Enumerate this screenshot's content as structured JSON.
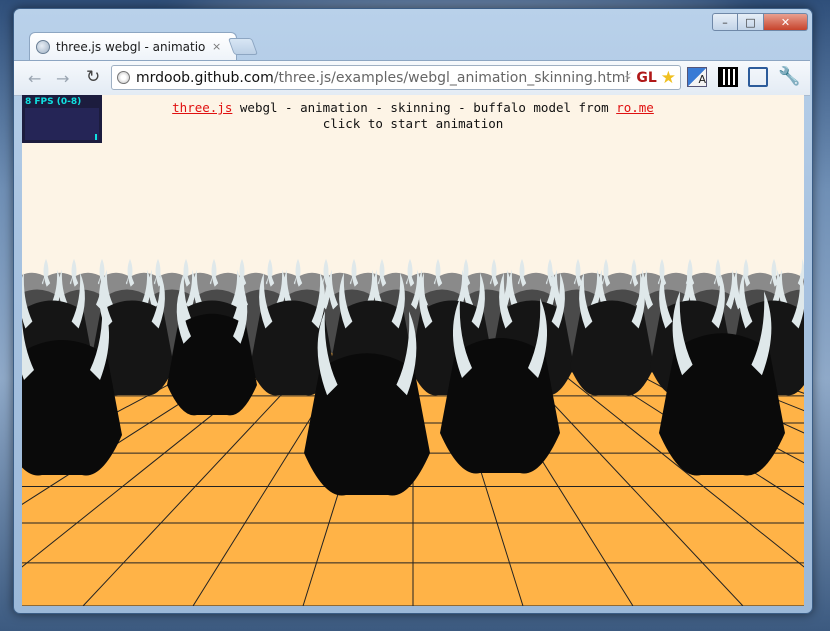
{
  "browser": {
    "tab_title": "three.js webgl - animation - ",
    "tab_close": "×",
    "controls": {
      "minimize": "–",
      "maximize": "□",
      "close": "✕"
    },
    "nav": {
      "back": "←",
      "forward": "→",
      "reload": "↻"
    },
    "url_host": "mrdoob.github.com",
    "url_path": "/three.js/examples/webgl_animation_skinning.html",
    "gl_badge": "GL",
    "bookmark_icon": "star-icon",
    "extensions": [
      "translate-icon",
      "qr-code-icon",
      "fullscreen-icon",
      "wrench-icon"
    ]
  },
  "page": {
    "stats": {
      "fps_text": "8 FPS (0-8)",
      "accent": "#10e0e0",
      "bg": "#1c1c3e"
    },
    "info": {
      "link1": "three.js",
      "text1": " webgl - animation - skinning - buffalo model from ",
      "link2": "ro.me",
      "line2": "click to start animation"
    },
    "colors": {
      "floor": "#ffb347",
      "sky": "#fdf4e6",
      "link": "#e01010"
    }
  }
}
